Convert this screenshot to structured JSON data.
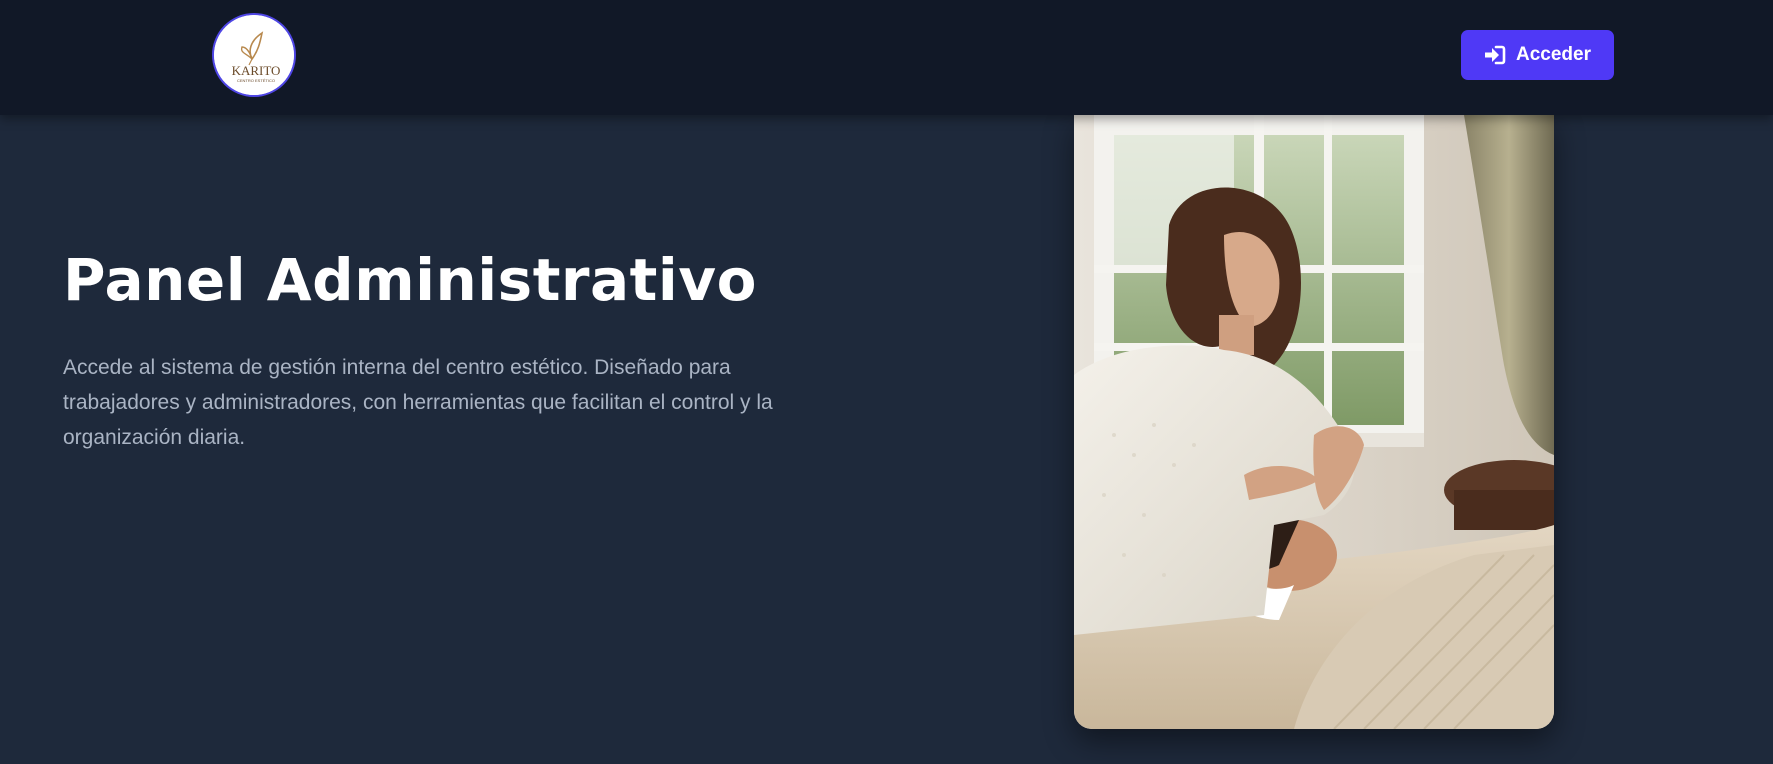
{
  "header": {
    "logo_text": "KARITO",
    "logo_subtext": "CENTRO ESTÉTICO",
    "login_button_label": "Acceder"
  },
  "hero": {
    "title": "Panel Administrativo",
    "description": "Accede al sistema de gestión interna del centro estético. Diseñado para trabajadores y administradores, con herramientas que facilitan el control y la organización diaria."
  },
  "colors": {
    "navbar_bg": "#111827",
    "page_bg": "#1e293b",
    "accent": "#4f39f6",
    "text_muted": "#aab4c4"
  },
  "icons": {
    "login": "sign-in-icon",
    "logo": "butterfly-icon"
  }
}
